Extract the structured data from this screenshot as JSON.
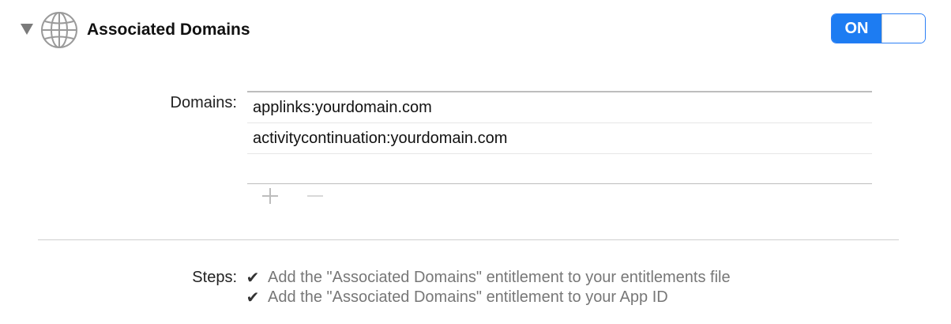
{
  "section": {
    "title": "Associated Domains",
    "expanded": true,
    "icon": "globe-icon",
    "toggle": {
      "label": "ON",
      "state": "on",
      "accent_color": "#1d7cf2"
    }
  },
  "domains": {
    "label": "Domains:",
    "items": [
      "applinks:yourdomain.com",
      "activitycontinuation:yourdomain.com"
    ],
    "add_icon": "plus-icon",
    "remove_icon": "minus-icon"
  },
  "steps": {
    "label": "Steps:",
    "items": [
      "Add the \"Associated Domains\" entitlement to your entitlements file",
      "Add the \"Associated Domains\" entitlement to your App ID"
    ],
    "check_icon": "checkmark-icon"
  }
}
